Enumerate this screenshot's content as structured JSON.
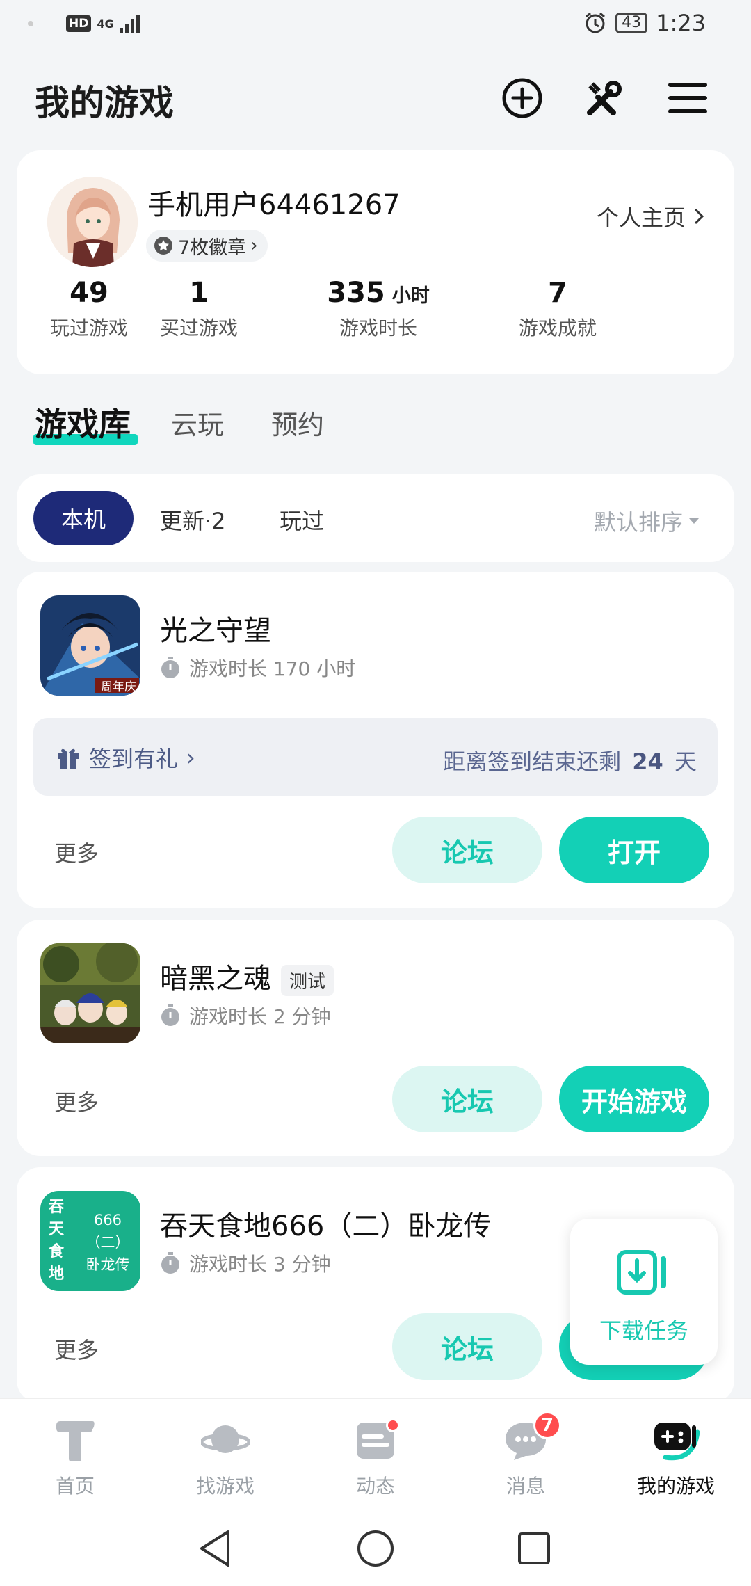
{
  "status_bar": {
    "network": "4G",
    "hd": "HD",
    "battery": "43",
    "time": "1:23"
  },
  "header": {
    "title": "我的游戏",
    "icons": [
      "add-circle-icon",
      "tools-icon",
      "menu-icon"
    ]
  },
  "profile": {
    "username": "手机用户64461267",
    "badges": "7枚徽章",
    "homepage_link": "个人主页",
    "stats": [
      {
        "value": "49",
        "unit": "",
        "label": "玩过游戏"
      },
      {
        "value": "1",
        "unit": "",
        "label": "买过游戏"
      },
      {
        "value": "335",
        "unit": "小时",
        "label": "游戏时长"
      },
      {
        "value": "7",
        "unit": "",
        "label": "游戏成就"
      }
    ]
  },
  "library_tabs": [
    "游戏库",
    "云玩",
    "预约"
  ],
  "filter": {
    "chips": [
      "本机",
      "更新·2",
      "玩过"
    ],
    "sort": "默认排序"
  },
  "games": [
    {
      "name": "光之守望",
      "icon_caption": "周年庆",
      "playtime": "游戏时长 170 小时",
      "signin": {
        "label": "签到有礼",
        "prefix": "距离签到结束还剩",
        "days": "24",
        "suffix": "天"
      },
      "more": "更多",
      "forum": "论坛",
      "action": "打开"
    },
    {
      "name": "暗黑之魂",
      "tag": "测试",
      "playtime": "游戏时长 2 分钟",
      "more": "更多",
      "forum": "论坛",
      "action": "开始游戏"
    },
    {
      "name": "吞天食地666（二）卧龙传",
      "icon_text_left": [
        "吞",
        "天",
        "食",
        "地"
      ],
      "icon_text_right": [
        "666",
        "（二）",
        "卧龙传"
      ],
      "playtime": "游戏时长 3 分钟",
      "more": "更多",
      "forum": "论坛"
    }
  ],
  "floating": {
    "label": "下载任务"
  },
  "bottom_nav": [
    {
      "label": "首页",
      "icon": "home-icon"
    },
    {
      "label": "找游戏",
      "icon": "planet-icon"
    },
    {
      "label": "动态",
      "icon": "feed-icon"
    },
    {
      "label": "消息",
      "icon": "message-icon",
      "badge": "7"
    },
    {
      "label": "我的游戏",
      "icon": "gamepad-icon"
    }
  ]
}
